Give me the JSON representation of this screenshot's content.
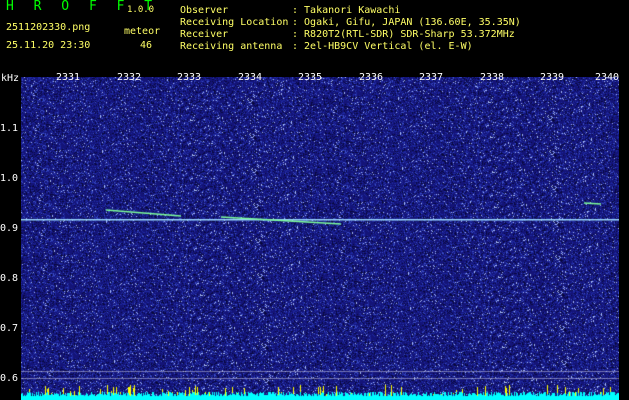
{
  "header": {
    "app_title": "H R O F F T",
    "version": "1.0.0",
    "filename": "2511202330.png",
    "datetime": "25.11.20 23:30",
    "meteor_label": "meteor",
    "meteor_count": "46",
    "fields": [
      {
        "label": "Observer",
        "value": ": Takanori Kawachi"
      },
      {
        "label": "Receiving Location",
        "value": ": Ogaki, Gifu, JAPAN (136.60E, 35.35N)"
      },
      {
        "label": "Receiver",
        "value": ": R820T2(RTL-SDR) SDR-Sharp 53.372MHz"
      },
      {
        "label": "Receiving antenna",
        "value": ": 2el-HB9CV Vertical (el. E-W)"
      }
    ]
  },
  "spectrogram": {
    "y_unit": "kHz",
    "x_ticks": [
      "2331",
      "2332",
      "2333",
      "2334",
      "2335",
      "2336",
      "2337",
      "2338",
      "2339",
      "2340"
    ],
    "y_ticks": [
      "1.1",
      "1.0",
      "0.9",
      "0.8",
      "0.7",
      "0.6"
    ],
    "colors": {
      "background": "#1a1a8c",
      "carrier": "#9ad8ff",
      "meteor": "#7dff9a",
      "activity_bar": "#00ffff",
      "activity_peak": "#ffff00"
    }
  }
}
